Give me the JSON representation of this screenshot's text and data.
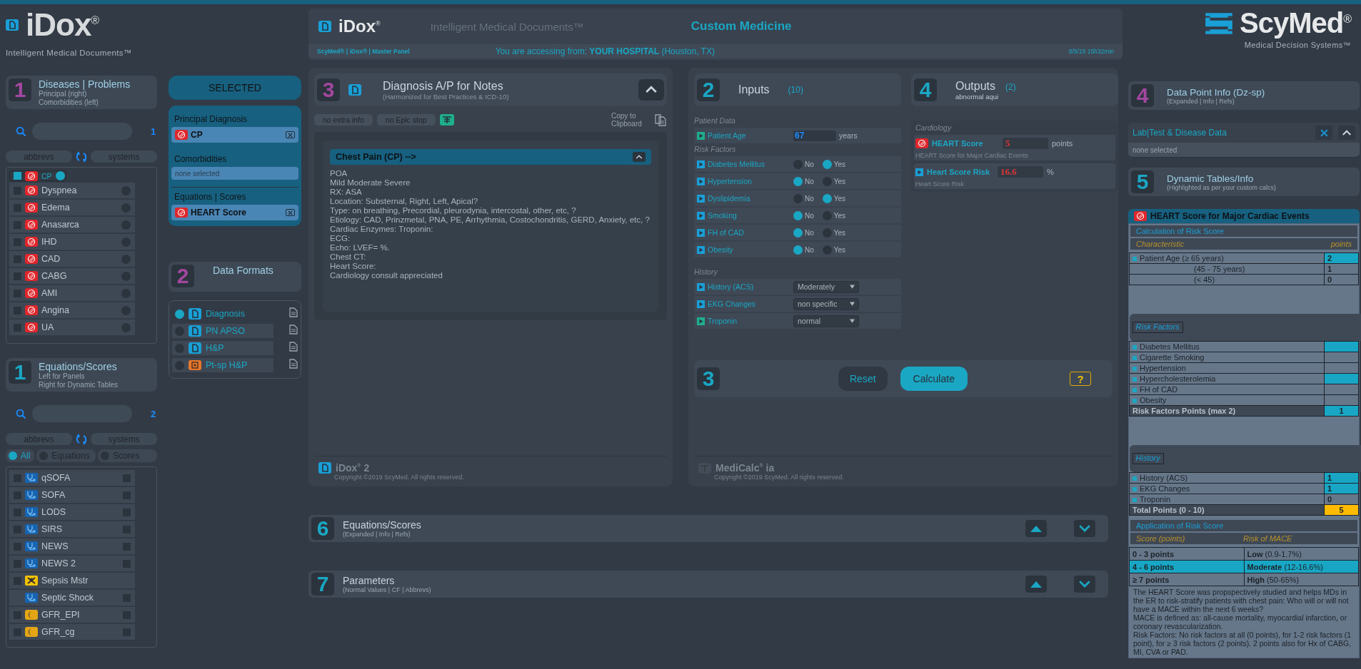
{
  "left_brand": {
    "wordmark": "iDox$^{®}$",
    "tagline": "Intelligent Medical Documents™"
  },
  "diseases_panel": {
    "number": "1",
    "title": "Diseases | Problems",
    "subtitle_lines": [
      "Principal (right)",
      "Comorbidities (left)"
    ],
    "search_count": "1",
    "sort_buttons": [
      "abbrevs",
      "systems"
    ],
    "items": [
      {
        "label": "CP",
        "checked": true,
        "selected": true
      },
      {
        "label": "Dyspnea",
        "checked": false,
        "selected": false
      },
      {
        "label": "Edema",
        "checked": false,
        "selected": false
      },
      {
        "label": "Anasarca",
        "checked": false,
        "selected": false
      },
      {
        "label": "IHD",
        "checked": false,
        "selected": false
      },
      {
        "label": "CAD",
        "checked": false,
        "selected": false
      },
      {
        "label": "CABG",
        "checked": false,
        "selected": false
      },
      {
        "label": "AMI",
        "checked": false,
        "selected": false
      },
      {
        "label": "Angina",
        "checked": false,
        "selected": false
      },
      {
        "label": "UA",
        "checked": false,
        "selected": false
      }
    ]
  },
  "equations_panel": {
    "number": "1",
    "title": "Equations/Scores",
    "subtitle_lines": [
      "Left for Panels",
      "Right for Dynamic Tables"
    ],
    "search_count": "2",
    "sort_buttons": [
      "abbrevs",
      "systems"
    ],
    "filters": [
      {
        "label": "All",
        "selected": true
      },
      {
        "label": "Equations",
        "selected": false
      },
      {
        "label": "Scores",
        "selected": false
      }
    ],
    "items": [
      {
        "label": "qSOFA",
        "kind": "equation",
        "checked": false,
        "table_checked": false
      },
      {
        "label": "SOFA",
        "kind": "equation",
        "checked": false,
        "table_checked": false
      },
      {
        "label": "LODS",
        "kind": "equation",
        "checked": false,
        "table_checked": false
      },
      {
        "label": "SIRS",
        "kind": "equation",
        "checked": false,
        "table_checked": false
      },
      {
        "label": "NEWS",
        "kind": "equation",
        "checked": false,
        "table_checked": false
      },
      {
        "label": "NEWS 2",
        "kind": "equation",
        "checked": false,
        "table_checked": false
      },
      {
        "label": "Sepsis Mstr",
        "kind": "master",
        "checked": false
      },
      {
        "label": "Septic Shock",
        "kind": "equation",
        "table_checked": false
      },
      {
        "label": "GFR_EPI",
        "kind": "renal",
        "checked": false,
        "table_checked": false
      },
      {
        "label": "GFR_cg",
        "kind": "renal",
        "checked": false,
        "table_checked": false
      }
    ]
  },
  "selected_panel": {
    "title": "SELECTED",
    "groups": [
      {
        "label": "Principal Diagnosis",
        "items": [
          "CP"
        ]
      },
      {
        "label": "Comorbidities",
        "empty_text": "none selected"
      },
      {
        "label": "Equations | Scores",
        "items": [
          "HEART Score"
        ]
      }
    ]
  },
  "formats_panel": {
    "number": "2",
    "title": "Data Formats",
    "items": [
      {
        "label": "Diagnosis",
        "kind": "document",
        "selected": true
      },
      {
        "label": "PN APSO",
        "kind": "document",
        "selected": false
      },
      {
        "label": "H&P",
        "kind": "document",
        "selected": false
      },
      {
        "label": "Pt-sp H&P",
        "kind": "patient",
        "selected": false
      }
    ]
  },
  "header": {
    "wordmark": "iDox$^{®}$",
    "tagline": "Intelligent Medical Documents™",
    "title": "Custom Medicine",
    "breadcrumb": "ScyMed® | iDox® | Master Panel",
    "access_text": "You are accessing from: **YOUR HOSPITAL** (Houston, TX)",
    "timestamp": "8/9/19 15h32min"
  },
  "notes_panel": {
    "number": "3",
    "title": "Diagnosis A/P for Notes",
    "subtitle": "(Harmonized for Best Practices & ICD-10)",
    "toggles": [
      "no extra info",
      "no Epic stop"
    ],
    "copy_label": "Copy to Clipboard",
    "section_title": "Chest Pain (CP) -->",
    "lines": [
      "POA",
      "Mild Moderate Severe",
      "RX: ASA",
      "Location: Substernal, Right, Left, Apical?",
      "Type: on breathing, Precordial, pleurodynia, intercostal, other, etc, ?",
      "Etiology: CAD, Prinzmetal, PNA, PE, Arrhythmia, Costochondritis, GERD, Anxiety, etc, ?",
      "Cardiac Enzymes: Troponin:",
      "ECG:",
      "Echo: LVEF= %.",
      "Chest CT:",
      "Heart Score:",
      "Cardiology consult appreciated"
    ],
    "footer_brand": "iDox$^{®}$ 2",
    "footer_copyright": "Copyright ©2019 ScyMed. All rights reserved."
  },
  "inputs_panel": {
    "number": "2",
    "title": "Inputs",
    "count": "(10)",
    "groups": [
      {
        "label": "Patient Data",
        "rows": [
          {
            "kind": "number",
            "label": "Patient Age",
            "color": "#1fae8c",
            "value": "67",
            "unit": "years"
          }
        ]
      },
      {
        "label": "Risk Factors",
        "rows": [
          {
            "kind": "yesno",
            "label": "Diabetes Mellitus",
            "color": "#1a9fd6",
            "options": [
              {
                "label": "No",
                "selected": false
              },
              {
                "label": "Yes",
                "selected": true
              }
            ]
          },
          {
            "kind": "yesno",
            "label": "Hypertension",
            "color": "#1a9fd6",
            "options": [
              {
                "label": "No",
                "selected": true
              },
              {
                "label": "Yes",
                "selected": false
              }
            ]
          },
          {
            "kind": "yesno",
            "label": "Dyslipidemia",
            "color": "#1a9fd6",
            "options": [
              {
                "label": "No",
                "selected": false
              },
              {
                "label": "Yes",
                "selected": true
              }
            ]
          },
          {
            "kind": "yesno",
            "label": "Smoking",
            "color": "#1a9fd6",
            "options": [
              {
                "label": "No",
                "selected": true
              },
              {
                "label": "Yes",
                "selected": false
              }
            ]
          },
          {
            "kind": "yesno",
            "label": "FH of CAD",
            "color": "#1a9fd6",
            "options": [
              {
                "label": "No",
                "selected": true
              },
              {
                "label": "Yes",
                "selected": false
              }
            ]
          },
          {
            "kind": "yesno",
            "label": "Obesity",
            "color": "#1a9fd6",
            "options": [
              {
                "label": "No",
                "selected": true
              },
              {
                "label": "Yes",
                "selected": false
              }
            ]
          }
        ]
      },
      {
        "label": "History",
        "rows": [
          {
            "kind": "select",
            "label": "History (ACS)",
            "color": "#1a9fd6",
            "value": "Moderately"
          },
          {
            "kind": "select",
            "label": "EKG Changes",
            "color": "#1a9fd6",
            "value": "non specific"
          },
          {
            "kind": "select",
            "label": "Troponin",
            "color": "#1fae8c",
            "value": "normal"
          }
        ]
      }
    ]
  },
  "outputs_panel": {
    "number": "4",
    "title": "Outputs",
    "count": "(2)",
    "subtitle": "abnormal aqui",
    "group": "Cardiology",
    "rows": [
      {
        "kind": "score",
        "label": "HEART Score",
        "value": "5",
        "unit": "points",
        "description": "HEART Score for Major Cardiac Events"
      },
      {
        "kind": "risk",
        "label": "Heart Score Risk",
        "value": "16.6",
        "unit": "%",
        "description": "Heart Score Risk"
      }
    ]
  },
  "actions": {
    "number": "3",
    "buttons": [
      {
        "label": "Reset",
        "kind": "secondary"
      },
      {
        "label": "Calculate",
        "kind": "primary"
      }
    ],
    "help": "?"
  },
  "medicalc_footer": {
    "brand": "MediCalc$^{®}$ ia",
    "copyright": "Copyright ©2019 ScyMed. All rights reserved."
  },
  "sections": [
    {
      "number": "6",
      "title": "Equations/Scores",
      "subtitle": "(Expanded | Info | Refs)"
    },
    {
      "number": "7",
      "title": "Parameters",
      "subtitle": "(Normal Values | CF | Abbrevs)"
    }
  ],
  "right_brand": {
    "wordmark": "ScyMed$^{®}$",
    "tagline": "Medical Decision Systems™"
  },
  "data_point_panel": {
    "number": "4",
    "title": "Data Point Info (Dz-sp)",
    "subtitle": "(Expanded | Info | Refs)"
  },
  "lab_panel": {
    "title": "Lab|Test & Disease Data",
    "empty_text": "none selected"
  },
  "dynamic_panel": {
    "number": "5",
    "title": "Dynamic Tables/Info",
    "subtitle": "(Highlighted as per your custom calcs)"
  },
  "heart_table": {
    "title": "HEART Score for Major Cardiac Events",
    "calc_heading": "Calculation of Risk Score",
    "col_characteristic": "Characteristic",
    "col_points": "points",
    "rows": [
      {
        "kind": "item",
        "label": "Patient Age (≥ 65 years)",
        "points": "2",
        "highlighted": true
      },
      {
        "kind": "sub",
        "label": "(45 - 75 years)",
        "points": "1",
        "highlighted": false
      },
      {
        "kind": "sub",
        "label": "(< 45)",
        "points": "0",
        "highlighted": false
      },
      {
        "kind": "section",
        "label": "Risk Factors"
      },
      {
        "kind": "item",
        "label": "Diabetes Mellitus",
        "points": "",
        "highlighted": true
      },
      {
        "kind": "item",
        "label": "Cigarette Smoking",
        "points": "",
        "highlighted": false
      },
      {
        "kind": "item",
        "label": "Hypertension",
        "points": "",
        "highlighted": false
      },
      {
        "kind": "item",
        "label": "Hypercholesterolemia",
        "points": "",
        "highlighted": true
      },
      {
        "kind": "item",
        "label": "FH of CAD",
        "points": "",
        "highlighted": false
      },
      {
        "kind": "item",
        "label": "Obesity",
        "points": "",
        "highlighted": false
      },
      {
        "kind": "subtotal",
        "label": "Risk Factors Points (max 2)",
        "points": "1",
        "highlighted": true
      },
      {
        "kind": "section",
        "label": "History"
      },
      {
        "kind": "item",
        "label": "History (ACS)",
        "points": "1",
        "highlighted": true
      },
      {
        "kind": "item",
        "label": "EKG Changes",
        "points": "1",
        "highlighted": true
      },
      {
        "kind": "item",
        "label": "Troponin",
        "points": "0",
        "highlighted": false
      },
      {
        "kind": "total",
        "label": "Total Points (0 - 10)",
        "points": "5",
        "highlighted": true
      }
    ],
    "application_heading": "Application of Risk Score",
    "col_score": "Score (points)",
    "col_risk": "Risk of MACE",
    "risk_rows": [
      {
        "score": "0 - 3 points",
        "risk": "**Low** (0.9-1.7%)",
        "selected": false
      },
      {
        "score": "4 - 6 points",
        "risk": "**Moderate** (12-16.6%)",
        "selected": true
      },
      {
        "score": "≥ 7 points",
        "risk": "**High** (50-65%)",
        "selected": false
      }
    ],
    "notes": [
      "The HEART Score was propspectively studied and helps MDs in the ER to risk-stratify patients with chest pain: Who will or will not have a MACE within the next 6 weeks?",
      "MACE is defined as: all-cause mortality, myocardial infarction, or coronary revascularization.",
      "Risk Factors: No risk factors at all (0 points), for 1-2 risk factors (1 point), for ≥ 3 risk factors (2 points). 2 points also for Hx of CABG, MI, CVA or PAD."
    ]
  }
}
